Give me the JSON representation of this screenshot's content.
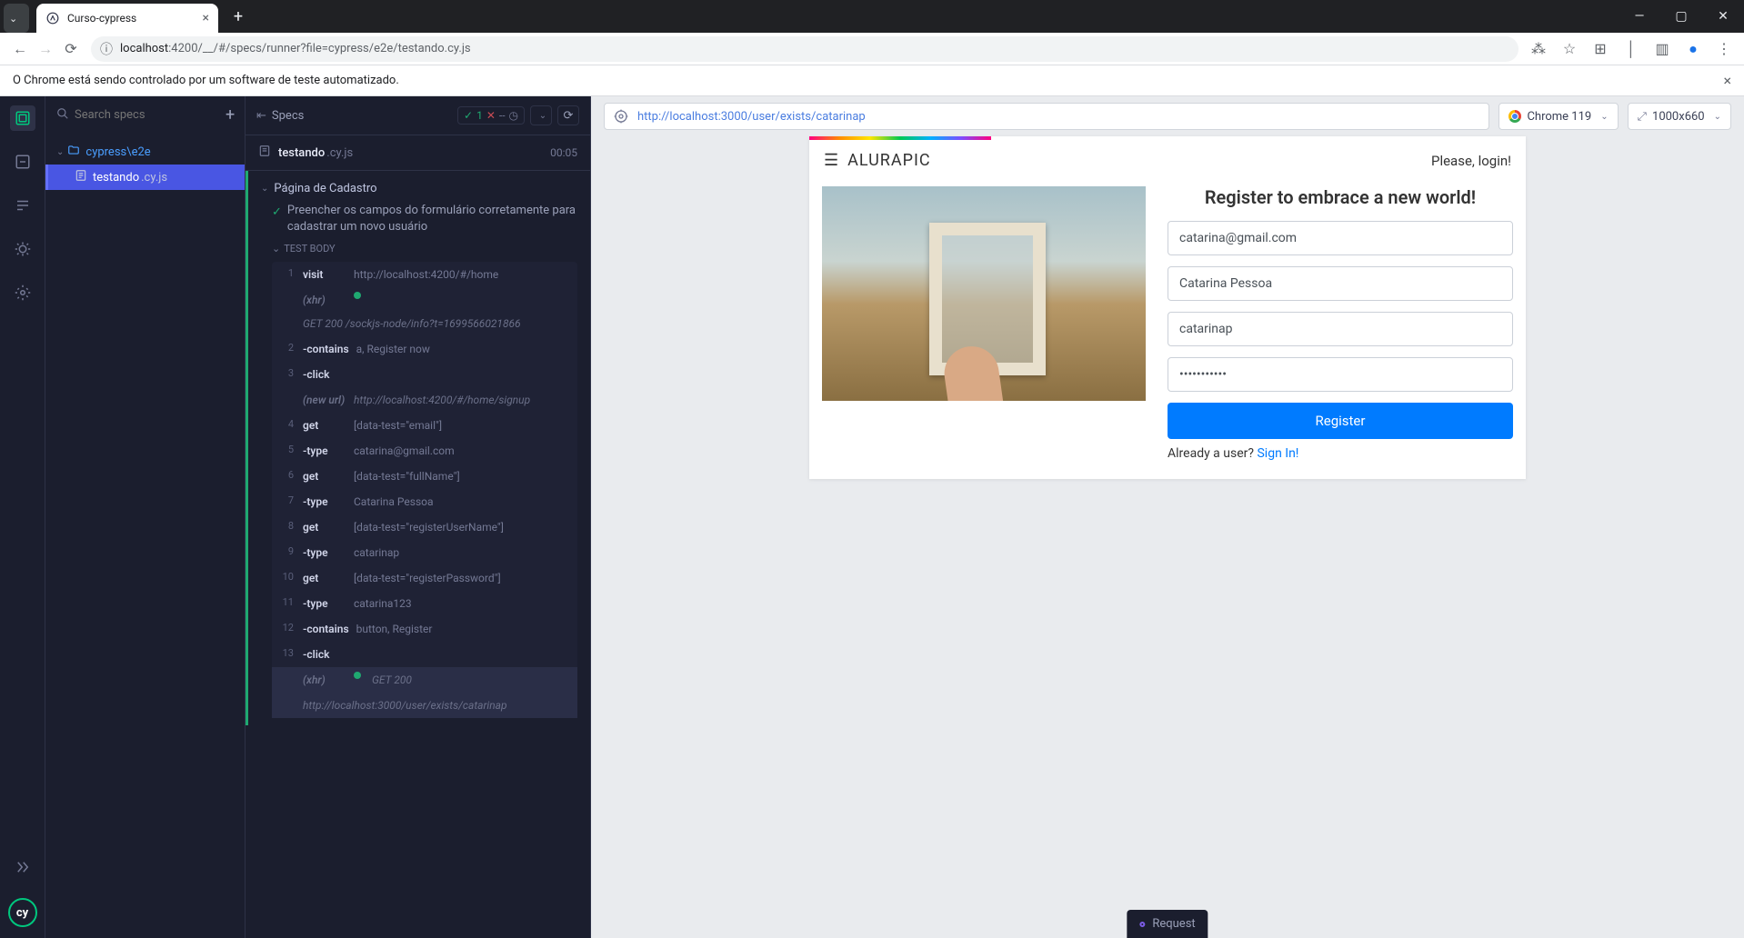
{
  "browser": {
    "tab_title": "Curso-cypress",
    "url_host": "localhost",
    "url_port_path": ":4200/__/#/specs/runner?file=cypress/e2e/testando.cy.js",
    "infobar": "O Chrome está sendo controlado por um software de teste automatizado."
  },
  "sidebar": {
    "search_placeholder": "Search specs",
    "folder": "cypress\\e2e",
    "file_name": "testando",
    "file_ext": ".cy.js"
  },
  "reporter": {
    "header_label": "Specs",
    "pass_count": "1",
    "fail_label": "✕",
    "pending": "--",
    "spec_title": "testando",
    "spec_ext": ".cy.js",
    "spec_time": "00:05",
    "suite": "Página de Cadastro",
    "test": "Preencher os campos do formulário corretamente para cadastrar um novo usuário",
    "hook": "TEST BODY",
    "commands": [
      {
        "num": "1",
        "name": "visit",
        "msg": "http://localhost:4200/#/home",
        "type": "cmd"
      },
      {
        "num": "",
        "name": "(xhr)",
        "msg": "GET 200 /sockjs-node/info?t=1699566021866",
        "type": "event",
        "dot": true
      },
      {
        "num": "2",
        "name": "-contains",
        "msg": "a, Register now",
        "type": "cmd"
      },
      {
        "num": "3",
        "name": "-click",
        "msg": "",
        "type": "cmd"
      },
      {
        "num": "",
        "name": "(new url)",
        "msg": "http://localhost:4200/#/home/signup",
        "type": "event"
      },
      {
        "num": "4",
        "name": "get",
        "msg": "[data-test=\"email\"]",
        "type": "cmd"
      },
      {
        "num": "5",
        "name": "-type",
        "msg": "catarina@gmail.com",
        "type": "cmd"
      },
      {
        "num": "6",
        "name": "get",
        "msg": "[data-test=\"fullName\"]",
        "type": "cmd"
      },
      {
        "num": "7",
        "name": "-type",
        "msg": "Catarina Pessoa",
        "type": "cmd"
      },
      {
        "num": "8",
        "name": "get",
        "msg": "[data-test=\"registerUserName\"]",
        "type": "cmd"
      },
      {
        "num": "9",
        "name": "-type",
        "msg": "catarinap",
        "type": "cmd"
      },
      {
        "num": "10",
        "name": "get",
        "msg": "[data-test=\"registerPassword\"]",
        "type": "cmd"
      },
      {
        "num": "11",
        "name": "-type",
        "msg": "catarina123",
        "type": "cmd"
      },
      {
        "num": "12",
        "name": "-contains",
        "msg": "button, Register",
        "type": "cmd"
      },
      {
        "num": "13",
        "name": "-click",
        "msg": "",
        "type": "cmd"
      },
      {
        "num": "",
        "name": "(xhr)",
        "msg": "GET 200",
        "type": "event",
        "dot": true,
        "hl": true
      },
      {
        "num": "",
        "name": "",
        "msg": "http://localhost:3000/user/exists/catarinap",
        "type": "event",
        "hl": true
      }
    ]
  },
  "aut": {
    "url": "http://localhost:3000/user/exists/catarinap",
    "browser_name": "Chrome 119",
    "viewport": "1000x660",
    "brand": "ALURAPIC",
    "login_text": "Please, login!",
    "form_title": "Register to embrace a new world!",
    "email": "catarina@gmail.com",
    "fullname": "Catarina Pessoa",
    "username": "catarinap",
    "password": "•••••••••••",
    "register_btn": "Register",
    "already": "Already a user? ",
    "signin": "Sign In!",
    "chip": "Request"
  }
}
